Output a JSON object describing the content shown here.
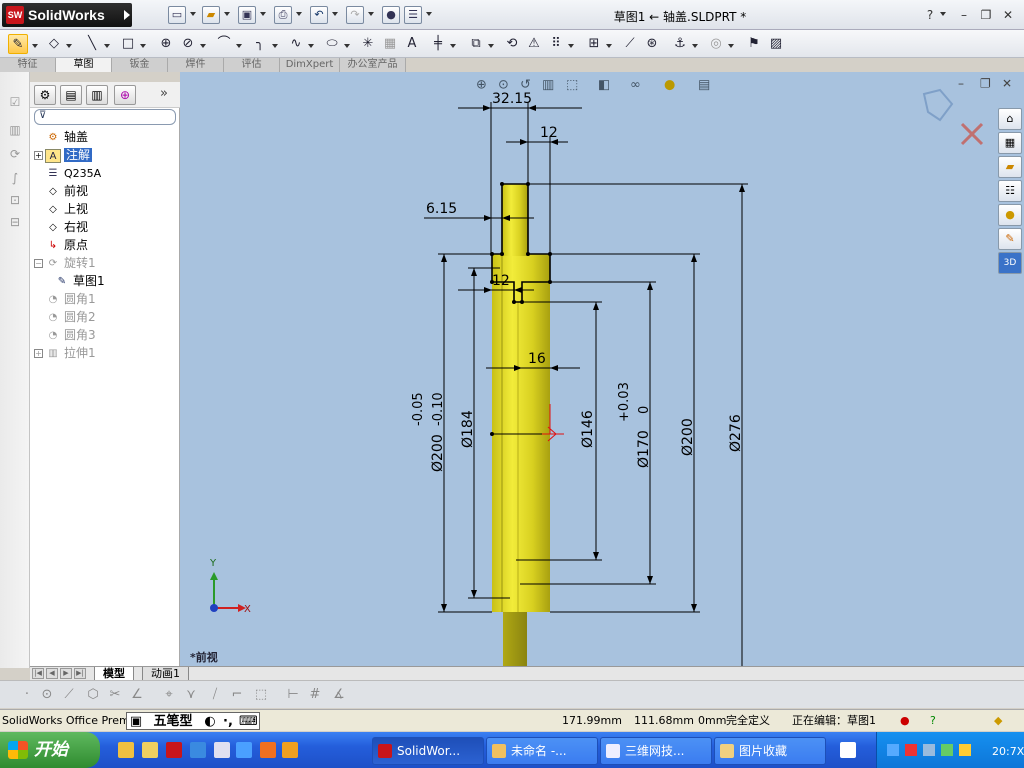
{
  "app": {
    "name": "SolidWorks",
    "document_title": "草图1 ← 轴盖.SLDPRT *"
  },
  "command_tabs": [
    "特征",
    "草图",
    "钣金",
    "焊件",
    "评估",
    "DimXpert",
    "办公室产品"
  ],
  "command_tabs_selected": "草图",
  "feature_tree": {
    "root": "轴盖",
    "items": [
      {
        "label": "注解",
        "icon": "annotations-icon",
        "expandable": true,
        "selected": true,
        "indent": 0
      },
      {
        "label": "Q235A",
        "icon": "material-icon",
        "expandable": false,
        "indent": 0
      },
      {
        "label": "前视",
        "icon": "plane-icon",
        "expandable": false,
        "indent": 0
      },
      {
        "label": "上视",
        "icon": "plane-icon",
        "expandable": false,
        "indent": 0
      },
      {
        "label": "右视",
        "icon": "plane-icon",
        "expandable": false,
        "indent": 0
      },
      {
        "label": "原点",
        "icon": "origin-icon",
        "expandable": false,
        "indent": 0
      },
      {
        "label": "旋转1",
        "icon": "revolve-icon",
        "expandable": true,
        "expanded": true,
        "greyed": true,
        "indent": 0
      },
      {
        "label": "草图1",
        "icon": "sketch-icon",
        "expandable": false,
        "indent": 1
      },
      {
        "label": "圆角1",
        "icon": "fillet-icon",
        "expandable": false,
        "greyed": true,
        "indent": 0
      },
      {
        "label": "圆角2",
        "icon": "fillet-icon",
        "expandable": false,
        "greyed": true,
        "indent": 0
      },
      {
        "label": "圆角3",
        "icon": "fillet-icon",
        "expandable": false,
        "greyed": true,
        "indent": 0
      },
      {
        "label": "拉伸1",
        "icon": "extrude-icon",
        "expandable": true,
        "greyed": true,
        "indent": 0
      }
    ]
  },
  "graphics": {
    "view_label": "*前视",
    "dimensions": {
      "top_width": "32.15",
      "top_12": "12",
      "left_615": "6.15",
      "step_12": "12",
      "step_16": "16",
      "d200_tol": "Ø200",
      "d200_tol_upper": "-0.05",
      "d200_tol_lower": "-0.10",
      "d184": "Ø184",
      "d146": "Ø146",
      "d170": "Ø170",
      "d170_tol_upper": "+0.03",
      "d170_tol_lower": "0",
      "d200": "Ø200",
      "d276": "Ø276"
    },
    "triad_axes": [
      "Y",
      "X"
    ],
    "colors": {
      "background": "#a8c2de",
      "part_fill": "#e8e020",
      "sketch_line": "#000000",
      "dim_line": "#000000"
    }
  },
  "bottom_tabs": [
    "模型",
    "动画1"
  ],
  "bottom_tab_selected": "模型",
  "status_bar": {
    "product": "SolidWorks Office Premium",
    "x": "171.99mm",
    "y": "111.68mm",
    "z": "0mm",
    "state": "完全定义",
    "editing": "正在编辑：草图1"
  },
  "ime": {
    "label": "五笔型"
  },
  "taskbar": {
    "start": "开始",
    "buttons": [
      "SolidWor...",
      "未命名 -...",
      "三维网技...",
      "图片收藏"
    ],
    "clock": "20:7X"
  }
}
